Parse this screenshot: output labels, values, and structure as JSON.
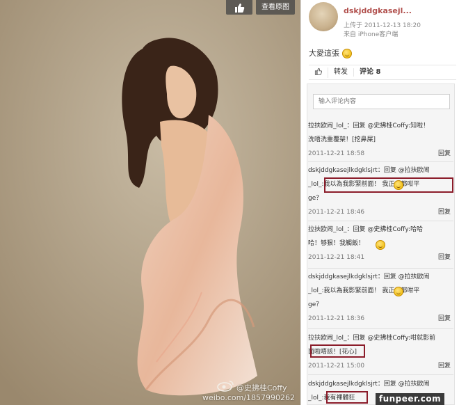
{
  "photo": {
    "like_icon": "thumbs-up-icon",
    "view_original_label": "查看原图",
    "watermark_name": "@史拂桂Coffy",
    "watermark_url": "weibo.com/1857990262"
  },
  "post": {
    "username": "dskjddgkasejl...",
    "upload_time": "上传于 2011-12-13 18:20",
    "source": "来自 iPhone客户端",
    "text": "大愛這張"
  },
  "actions": {
    "like_icon": "thumbs-up-icon",
    "repost_label": "转发",
    "comment_label": "评论 8"
  },
  "comment_input": {
    "placeholder": "输入评论内容"
  },
  "comments": [
    {
      "l1": "拉扶欧闹_lol_：回复 @史拂桂Coffy:知啦！",
      "l2": "洗唔洗重覆架！[挖鼻屎]",
      "date": "2011-12-21 18:58",
      "reply": "回复"
    },
    {
      "l1": "dskjddgkasejlkdgklsjrt：回复 @拉扶欧闹",
      "l2": "_lol_:我以為我影緊前面！  我正反都咁平",
      "l3": "ge？",
      "date": "2011-12-21 18:46",
      "reply": "回复"
    },
    {
      "l1": "拉扶欧闹_lol_：回复 @史拂桂Coffy:哈哈",
      "l2": "哈！够狠！我觸飯！",
      "date": "2011-12-21 18:41",
      "reply": "回复"
    },
    {
      "l1": "dskjddgkasejlkdgklsjrt：回复 @拉扶欧闹",
      "l2": "_lol_:我以為我影緊前面！  我正反都咁平",
      "l3": "ge？",
      "date": "2011-12-21 18:36",
      "reply": "回复"
    },
    {
      "l1": "拉扶欧闹_lol_：回复 @史拂桂Coffy:咁就影前",
      "l2": "面啦唔該！[花心]",
      "date": "2011-12-21 15:00",
      "reply": "回复"
    },
    {
      "l1": "dskjddgkasejlkdgklsjrt：回复 @拉扶欧闹",
      "l2": "_lol_:我有裸體狂"
    }
  ],
  "footer": {
    "brand": "funpeer.com"
  },
  "colors": {
    "username": "#b1504d",
    "link": "#c65a2a",
    "highlight": "#8b1c2a"
  }
}
